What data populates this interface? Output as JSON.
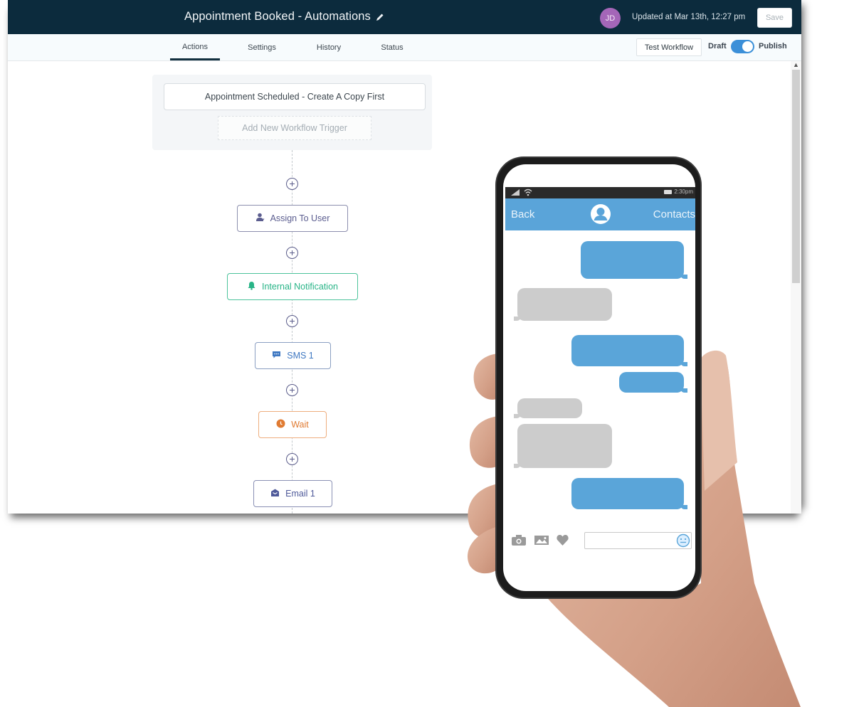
{
  "header": {
    "title": "Appointment Booked - Automations",
    "avatar_initials": "JD",
    "updated_text": "Updated at Mar 13th, 12:27 pm",
    "save_label": "Save"
  },
  "tabs": [
    {
      "label": "Actions",
      "active": true
    },
    {
      "label": "Settings",
      "active": false
    },
    {
      "label": "History",
      "active": false
    },
    {
      "label": "Status",
      "active": false
    }
  ],
  "toolbar": {
    "test_workflow_label": "Test Workflow",
    "draft_label": "Draft",
    "publish_label": "Publish",
    "publish_toggle_on": true
  },
  "triggers": {
    "items": [
      "Appointment Scheduled - Create A Copy First"
    ],
    "add_label": "Add New Workflow Trigger"
  },
  "actions": [
    {
      "label": "Assign To User",
      "icon": "assign-user-icon",
      "color": "#5b5d8f"
    },
    {
      "label": "Internal Notification",
      "icon": "bell-icon",
      "color": "#28b487"
    },
    {
      "label": "SMS 1",
      "icon": "chat-bubble-icon",
      "color": "#3f78c2"
    },
    {
      "label": "Wait",
      "icon": "clock-icon",
      "color": "#e07b32"
    },
    {
      "label": "Email 1",
      "icon": "envelope-icon",
      "color": "#4f5a9a"
    }
  ],
  "phone": {
    "time": "2:30pm",
    "back_label": "Back",
    "contacts_label": "Contacts",
    "message_input_value": ""
  },
  "colors": {
    "header_bg": "#0c2b3d",
    "toggle_on": "#3b8fd8",
    "bubble_out": "#5aa5d9",
    "bubble_in": "#cccccc"
  }
}
